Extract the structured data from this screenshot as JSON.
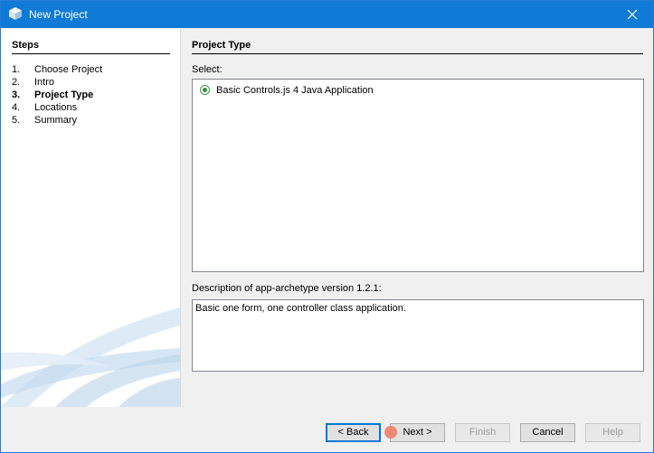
{
  "window": {
    "title": "New Project",
    "title_icon": "netbeans-cube-icon",
    "accent_color": "#0f7bd6"
  },
  "steps": {
    "title": "Steps",
    "items": [
      {
        "num": "1.",
        "label": "Choose Project",
        "current": false
      },
      {
        "num": "2.",
        "label": "Intro",
        "current": false
      },
      {
        "num": "3.",
        "label": "Project Type",
        "current": true
      },
      {
        "num": "4.",
        "label": "Locations",
        "current": false
      },
      {
        "num": "5.",
        "label": "Summary",
        "current": false
      }
    ]
  },
  "main": {
    "section_title": "Project Type",
    "select_label": "Select:",
    "options": [
      {
        "label": "Basic Controls.js 4 Java Application",
        "selected": true
      }
    ],
    "description_label": "Description of app-archetype version 1.2.1:",
    "description_text": "Basic one form, one controller class application."
  },
  "buttons": {
    "back": "< Back",
    "next": "Next >",
    "finish": "Finish",
    "cancel": "Cancel",
    "help": "Help"
  }
}
